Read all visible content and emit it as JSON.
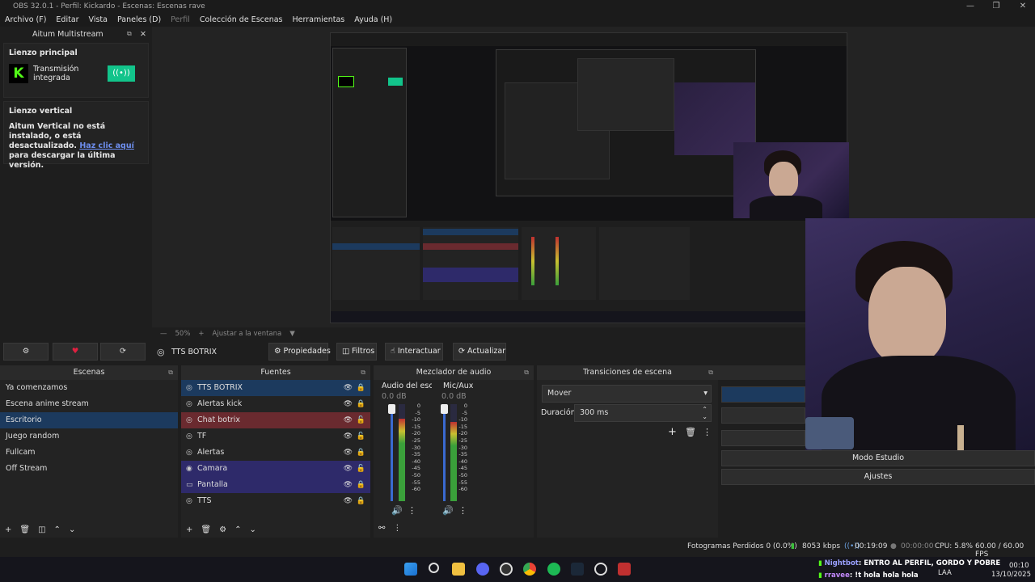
{
  "window": {
    "title": "OBS 32.0.1 - Perfil: Kickardo - Escenas: Escenas rave",
    "controls": [
      "—",
      "❐",
      "✕"
    ]
  },
  "menu": [
    "Archivo (F)",
    "Editar",
    "Vista",
    "Paneles (D)",
    "Perfil",
    "Colección de Escenas",
    "Herramientas",
    "Ayuda (H)"
  ],
  "dock": {
    "title": "Aitum Multistream",
    "main_canvas_label": "Lienzo principal",
    "integrated_label": "Transmisión integrada",
    "kick_logo": "K",
    "toggle_icon": "((•))",
    "vertical_label": "Lienzo vertical",
    "vertical_msg": "Aitum Vertical no está instalado, o está desactualizado.",
    "link_text": "Haz clic aquí",
    "link_rest": " para descargar la última versión.",
    "btn_settings": "⚙",
    "btn_heart": "♥",
    "btn_refresh": "⟳"
  },
  "zoom": {
    "minus": "—",
    "value": "50%",
    "plus": "+",
    "fit": "Ajustar a la ventana",
    "arrow": "▼"
  },
  "toolbar": {
    "source_name": "TTS BOTRIX",
    "properties": "Propiedades",
    "filters": "Filtros",
    "interact": "Interactuar",
    "refresh": "Actualizar"
  },
  "scenes": {
    "title": "Escenas",
    "items": [
      "Ya comenzamos",
      "Escena anime stream",
      "Escritorio",
      "Juego random",
      "Fullcam",
      "Off Stream"
    ],
    "selected": 2
  },
  "sources": {
    "title": "Fuentes",
    "items": [
      {
        "name": "TTS BOTRIX",
        "icon": "◎",
        "color": "#1c3a5e",
        "locked": true
      },
      {
        "name": "Alertas kick",
        "icon": "◎",
        "color": "",
        "locked": true
      },
      {
        "name": "Chat botrix",
        "icon": "◎",
        "color": "#6a2a2f",
        "locked": false
      },
      {
        "name": "TF",
        "icon": "◎",
        "color": "",
        "locked": false
      },
      {
        "name": "Alertas",
        "icon": "◎",
        "color": "",
        "locked": true
      },
      {
        "name": "Camara",
        "icon": "◉",
        "color": "#2e2a6a",
        "locked": false
      },
      {
        "name": "Pantalla",
        "icon": "▭",
        "color": "#2e2a6a",
        "locked": true
      },
      {
        "name": "TTS",
        "icon": "◎",
        "color": "",
        "locked": true
      }
    ]
  },
  "mixer": {
    "title": "Mezclador de audio",
    "ch1_name": "Audio del escrito",
    "ch1_db": "0.0 dB",
    "ch2_name": "Mic/Aux",
    "ch2_db": "0.0 dB",
    "scale": [
      "0",
      "-5",
      "-10",
      "-15",
      "-20",
      "-25",
      "-30",
      "-35",
      "-40",
      "-45",
      "-50",
      "-55",
      "-60"
    ],
    "ch1_level": 0.85,
    "ch2_level": 0.82
  },
  "transitions": {
    "title": "Transiciones de escena",
    "selected": "Mover",
    "duration_label": "Duración",
    "duration_value": "300 ms"
  },
  "controls": {
    "studio_mode": "Modo Estudio",
    "settings": "Ajustes"
  },
  "status": {
    "dropped": "Fotogramas Perdidos 0 (0.0%)",
    "bitrate": "8053 kbps",
    "live_time": "00:19:09",
    "rec_time": "00:00:00",
    "cpu": "CPU: 5.8%",
    "fps": "60.00 / 60.00 FPS"
  },
  "chat": {
    "line1_user": "Nightbot",
    "line1_msg": ": ENTRO AL PERFIL, GORDO Y POBRE",
    "line2_user": "rravee",
    "line2_msg": ": !t hola hola hola"
  },
  "tray": {
    "lang": "LAA",
    "time": "00:10",
    "date": "13/10/2025"
  },
  "colors": {
    "accent": "#1c3a5e",
    "kick": "#53fc18",
    "toggle": "#12c48b"
  }
}
